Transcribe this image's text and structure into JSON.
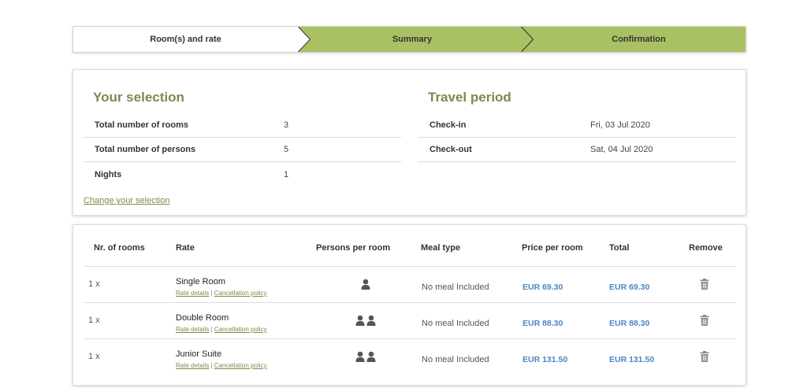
{
  "steps": [
    {
      "label": "Room(s) and rate"
    },
    {
      "label": "Summary"
    },
    {
      "label": "Confirmation"
    }
  ],
  "selection": {
    "title": "Your selection",
    "rows": [
      {
        "label": "Total number of rooms",
        "value": "3"
      },
      {
        "label": "Total number of persons",
        "value": "5"
      },
      {
        "label": "Nights",
        "value": "1"
      }
    ],
    "change_link": "Change your selection"
  },
  "travel": {
    "title": "Travel period",
    "rows": [
      {
        "label": "Check-in",
        "value": "Fri, 03 Jul 2020"
      },
      {
        "label": "Check-out",
        "value": "Sat, 04 Jul 2020"
      }
    ]
  },
  "rooms_table": {
    "headers": {
      "nr": "Nr. of rooms",
      "rate": "Rate",
      "persons": "Persons per room",
      "meal": "Meal type",
      "price": "Price per room",
      "total": "Total",
      "remove": "Remove"
    },
    "rate_details_label": "Rate details",
    "separator": "|",
    "cancellation_label": "Cancellation policy",
    "rows": [
      {
        "qty": "1 x",
        "name": "Single Room",
        "persons": 1,
        "meal": "No meal Included",
        "price": "EUR 69.30",
        "total": "EUR  69.30"
      },
      {
        "qty": "1 x",
        "name": "Double Room",
        "persons": 2,
        "meal": "No meal Included",
        "price": "EUR 88.30",
        "total": "EUR  88.30"
      },
      {
        "qty": "1 x",
        "name": "Junior Suite",
        "persons": 2,
        "meal": "No meal Included",
        "price": "EUR 131.50",
        "total": "EUR  131.50"
      }
    ]
  },
  "icons": {
    "person": "person-icon",
    "remove": "trash-icon"
  },
  "colors": {
    "accent_green": "#a9c163",
    "title_olive": "#7e8a4a",
    "price_blue": "#4a86c5"
  }
}
